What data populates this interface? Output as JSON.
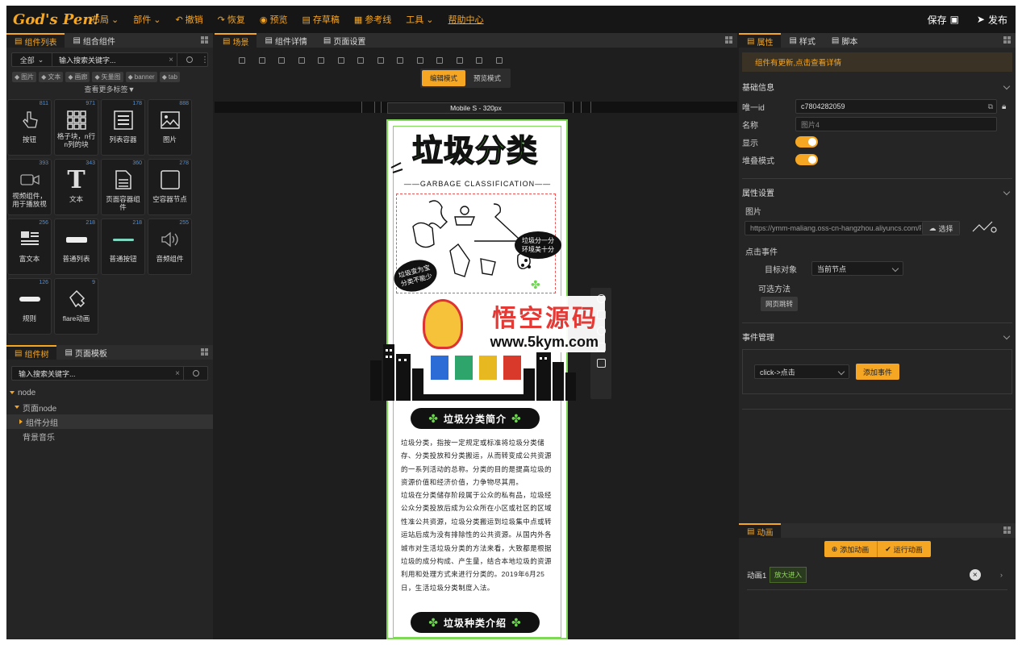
{
  "app": {
    "logo": "God's Pen!"
  },
  "topbar": {
    "menus": [
      {
        "label": "布局",
        "caret": true
      },
      {
        "label": "部件",
        "caret": true
      },
      {
        "label": "撤销",
        "icon": "undo-icon"
      },
      {
        "label": "恢复",
        "icon": "redo-icon"
      },
      {
        "label": "预览",
        "icon": "eye-icon"
      },
      {
        "label": "存草稿",
        "icon": "draft-icon"
      },
      {
        "label": "参考线",
        "icon": "grid-icon"
      },
      {
        "label": "工具",
        "caret": true
      },
      {
        "label": "帮助中心",
        "link": true
      }
    ],
    "save": "保存",
    "publish": "发布"
  },
  "left": {
    "tabs": [
      "组件列表",
      "组合组件"
    ],
    "filter": "全部",
    "search_placeholder": "输入搜索关键字...",
    "tags": [
      "图片",
      "文本",
      "画廊",
      "矢量图",
      "banner",
      "tab"
    ],
    "more_tags": "查看更多标签▼",
    "components": [
      {
        "label": "按钮",
        "count": "811",
        "icon": "hand-pointer-icon"
      },
      {
        "label": "格子块，n行n列的块",
        "count": "971",
        "icon": "grid-blocks-icon"
      },
      {
        "label": "列表容器",
        "count": "178",
        "icon": "list-icon"
      },
      {
        "label": "图片",
        "count": "888",
        "icon": "image-icon"
      },
      {
        "label": "视频组件，用于播放视",
        "count": "393",
        "icon": "video-icon"
      },
      {
        "label": "文本",
        "count": "343",
        "icon": "text-icon"
      },
      {
        "label": "页面容器组件",
        "count": "360",
        "icon": "page-icon"
      },
      {
        "label": "空容器节点",
        "count": "278",
        "icon": "box-icon"
      },
      {
        "label": "富文本",
        "count": "256",
        "icon": "richtext-icon"
      },
      {
        "label": "普通列表",
        "count": "218",
        "icon": "list-bar-icon"
      },
      {
        "label": "普通按钮",
        "count": "218",
        "icon": "button-bar-icon"
      },
      {
        "label": "音频组件",
        "count": "255",
        "icon": "audio-icon"
      },
      {
        "label": "规则",
        "count": "126",
        "icon": "rule-icon"
      },
      {
        "label": "flare动画",
        "count": "9",
        "icon": "flare-icon"
      }
    ],
    "tree_tabs": [
      "组件树",
      "页面模板"
    ],
    "tree_search_placeholder": "输入搜索关键字...",
    "tree": [
      {
        "label": "node",
        "indent": 0,
        "arrow": "down"
      },
      {
        "label": "页面node",
        "indent": 1,
        "arrow": "down"
      },
      {
        "label": "组件分组",
        "indent": 2,
        "arrow": "right",
        "selected": true
      },
      {
        "label": "背景音乐",
        "indent": 2,
        "arrow": "none"
      }
    ]
  },
  "center": {
    "tabs": [
      "场景",
      "组件详情",
      "页面设置"
    ],
    "modes": [
      "编辑模式",
      "预览模式"
    ],
    "device": "Mobile S - 320px",
    "page": {
      "title": "垃圾分类",
      "subtitle": "——GARBAGE CLASSIFICATION——",
      "bubble1": "垃圾分一分 环境美十分",
      "bubble2": "垃圾变为宝 分类不能少",
      "section1": "垃圾分类简介",
      "para1": "垃圾分类，指按一定规定或标准将垃圾分类储存、分类投放和分类搬运，从而转变成公共资源的一系列活动的总称。分类的目的是提高垃圾的资源价值和经济价值，力争物尽其用。",
      "para2": "垃圾在分类储存阶段属于公众的私有品，垃圾经公众分类投放后成为公众所在小区或社区的区域性准公共资源，垃圾分类搬运到垃圾集中点或转运站后成为没有排除性的公共资源。从国内外各城市对生活垃圾分类的方法来看，大致都是根据垃圾的成分构成、产生量，结合本地垃圾的资源利用和处理方式来进行分类的。2019年6月25日，生活垃圾分类制度入法。",
      "section2": "垃圾种类介绍"
    },
    "watermark": {
      "title": "悟空源码",
      "url": "www.5kym.com"
    }
  },
  "right": {
    "tabs": [
      "属性",
      "样式",
      "脚本"
    ],
    "notice": "组件有更新,点击查看详情",
    "basic_title": "基础信息",
    "uid_label": "唯一id",
    "uid": "c7804282059",
    "name_label": "名称",
    "name_placeholder": "图片4",
    "show_label": "显示",
    "stack_label": "堆叠模式",
    "props_title": "属性设置",
    "image_label": "图片",
    "image_url": "https://ymm-maliang.oss-cn-hangzhou.aliyuncs.com/F",
    "choose": "选择",
    "click_event": "点击事件",
    "target_label": "目标对象",
    "target_value": "当前节点",
    "methods_label": "可选方法",
    "method": "网页跳转",
    "events_title": "事件管理",
    "event_select": "click->点击",
    "add_event": "添加事件",
    "anim_tab": "动画",
    "add_anim": "添加动画",
    "run_anim": "运行动画",
    "anim_name": "动画1",
    "anim_effect": "放大进入"
  }
}
